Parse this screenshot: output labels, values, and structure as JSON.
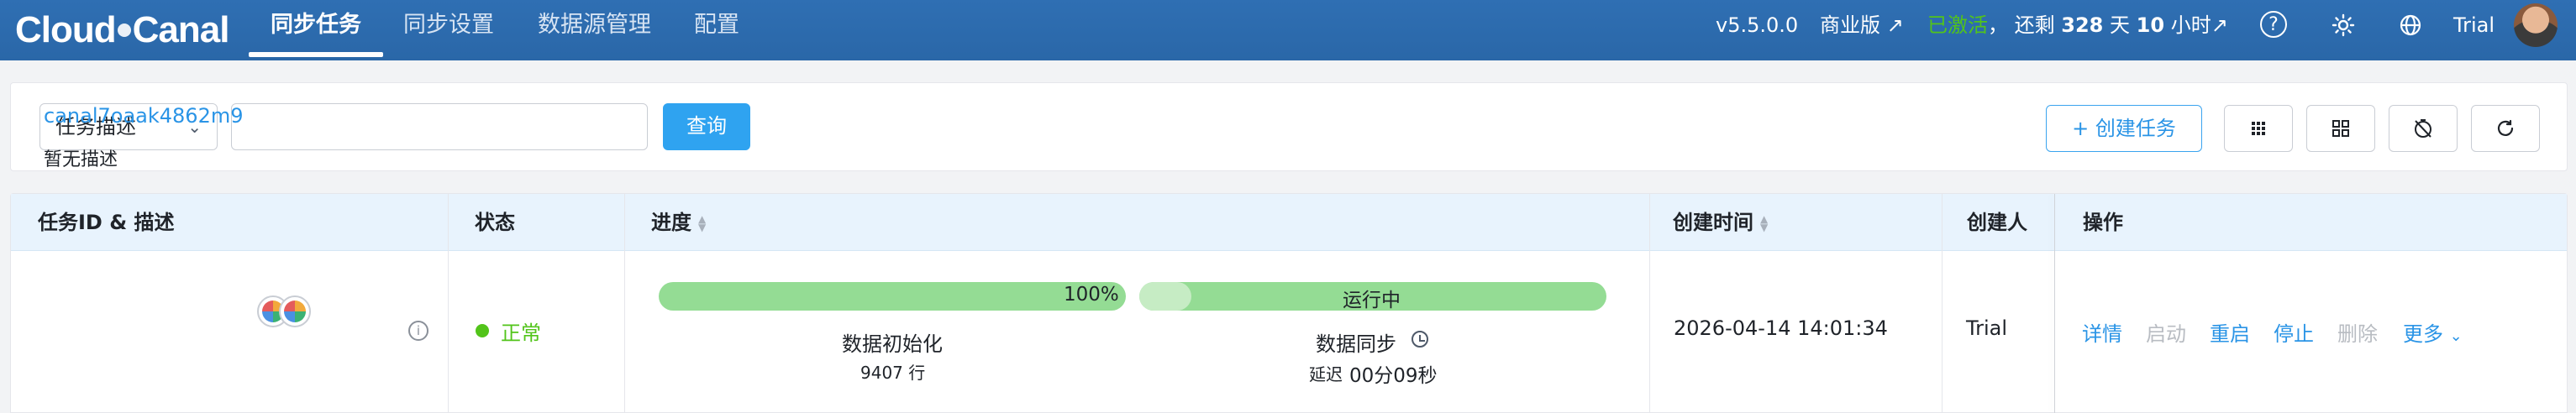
{
  "app": {
    "logo": "CloudCanal"
  },
  "nav": {
    "items": [
      "同步任务",
      "同步设置",
      "数据源管理",
      "配置"
    ],
    "active_index": 0
  },
  "topbar": {
    "version": "v5.5.0.0",
    "edition": "商业版 ↗",
    "activated": "已激活",
    "separator": "，",
    "remaining_prefix": "还剩",
    "remaining_days": "328",
    "days_unit": "天",
    "remaining_hours": "10",
    "hours_unit": "小时↗",
    "help_icon": "help-circle-icon",
    "theme_icon": "sun-icon",
    "language_icon": "globe-icon",
    "user": "Trial"
  },
  "filter": {
    "select_value": "任务描述",
    "search_value": "",
    "search_placeholder": "",
    "query_label": "查询",
    "create_label": "+ 创建任务",
    "tool_icons": [
      "grid-icon",
      "layout-icon",
      "timer-off-icon",
      "refresh-icon"
    ]
  },
  "table": {
    "columns": {
      "task": "任务ID & 描述",
      "status": "状态",
      "progress": "进度",
      "created_time": "创建时间",
      "creator": "创建人",
      "actions": "操作"
    },
    "rows": [
      {
        "task_id": "canal7oaak4862m9",
        "description": "暂无描述",
        "status": "正常",
        "status_color": "#52c41a",
        "init_progress_text": "100%",
        "init_progress": 1.0,
        "init_stage": "数据初始化",
        "init_rows": "9407 行",
        "sync_status": "运行中",
        "sync_stage": "数据同步",
        "delay_label": "延迟",
        "delay_value": "00分09秒",
        "created_time": "2026-04-14 14:01:34",
        "creator": "Trial",
        "actions": {
          "details": "详情",
          "start": "启动",
          "restart": "重启",
          "stop": "停止",
          "delete": "删除",
          "more": "更多"
        }
      }
    ]
  },
  "colors": {
    "topbar": "#2a67a8",
    "accent": "#2a94e6",
    "success": "#52c41a",
    "progress": "#94dc94",
    "header_bg": "#e8f3fd"
  }
}
